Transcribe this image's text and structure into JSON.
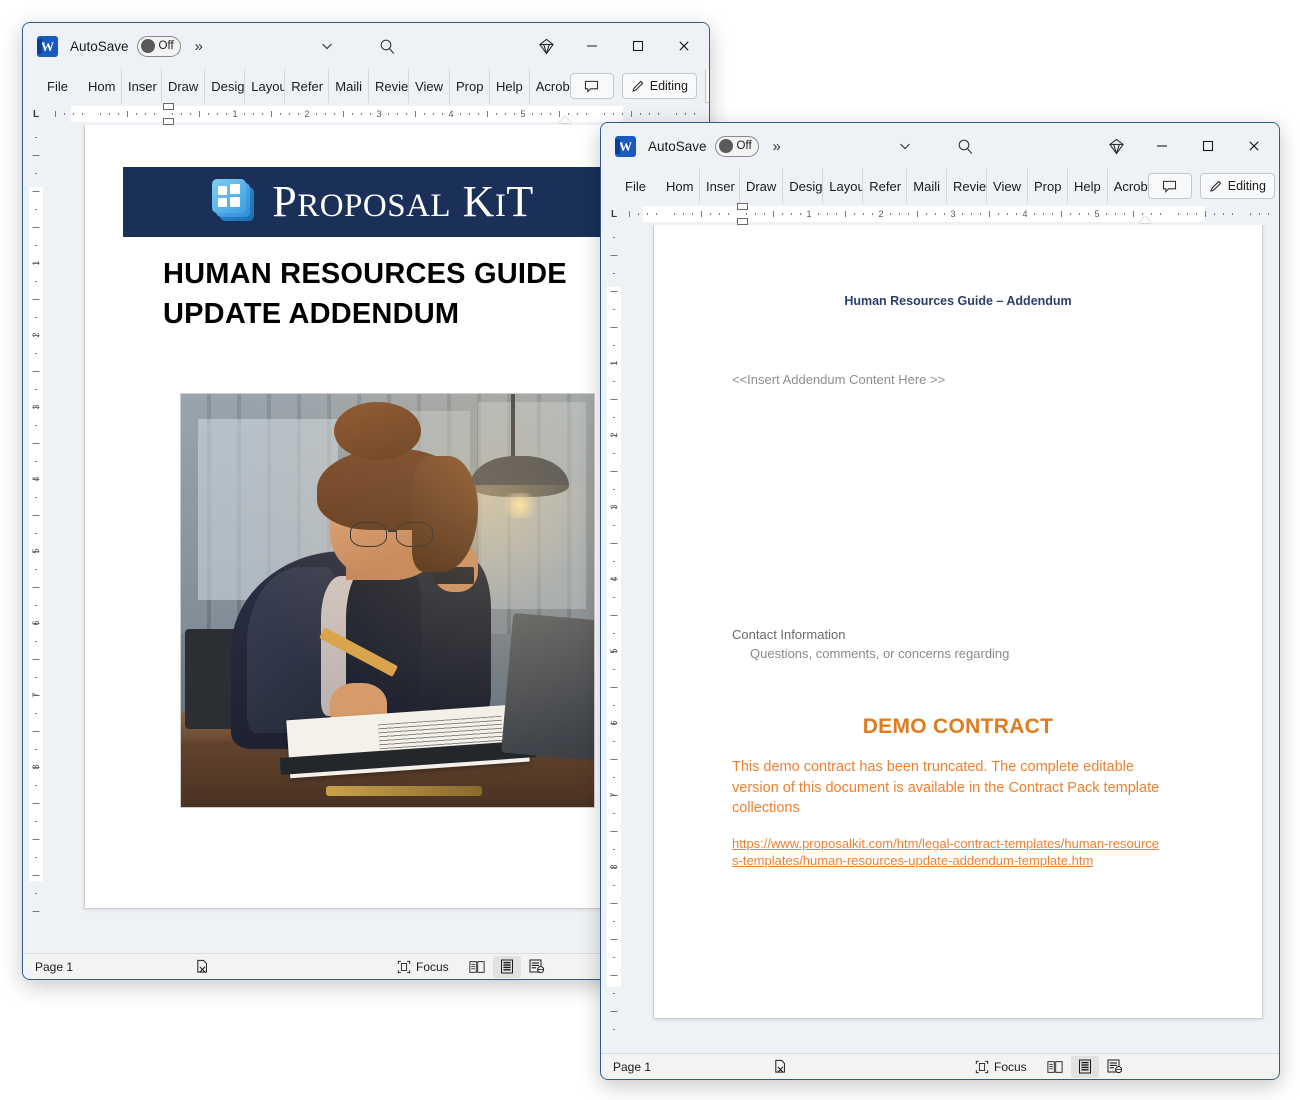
{
  "app": {
    "titlebar": {
      "autosave_label": "AutoSave",
      "toggle_state": "Off",
      "overflow_glyph": "»",
      "caption_chevron": "⌄",
      "search_icon": "search-icon",
      "copilot_icon": "copilot-diamond-icon",
      "minimize_icon": "minimize-icon",
      "maximize_icon": "maximize-icon",
      "close_icon": "close-icon"
    },
    "ribbon": {
      "tabs": [
        "File",
        "Home",
        "Insert",
        "Draw",
        "Design",
        "Layout",
        "References",
        "Mailings",
        "Review",
        "View",
        "Properties",
        "Help",
        "Acrobat"
      ],
      "tabs_display": [
        "File",
        "Hom",
        "Inser",
        "Draw",
        "Desig",
        "Layou",
        "Refer",
        "Maili",
        "Revie",
        "View",
        "Prop",
        "Help",
        "Acrob"
      ],
      "comment_button": "Comments",
      "editing_button": "Editing",
      "editing_overflow_glyph": "›"
    },
    "ruler": {
      "tab_selector": "L",
      "h_numbers": [
        "1",
        "2",
        "3",
        "4",
        "5"
      ],
      "v_numbers": [
        "1",
        "2",
        "3",
        "4",
        "5",
        "6",
        "7",
        "8"
      ]
    },
    "statusbar": {
      "page_label": "Page 1",
      "proofing_icon": "proofing-errors-icon",
      "focus_label": "Focus",
      "view_read_icon": "read-mode-icon",
      "view_print_icon": "print-layout-icon",
      "view_web_icon": "web-layout-icon"
    }
  },
  "colors": {
    "banner_navy": "#1b3058",
    "accent_orange": "#ef8030",
    "demo_orange": "#e07b1e",
    "heading_navy": "#2b3f6c",
    "window_border": "#2f5c8f"
  },
  "window_back": {
    "document": {
      "banner_brand": "PROPOSAL KIT",
      "banner_brand_main": "ROPOSAL",
      "banner_brand_cap_p": "P",
      "banner_brand_k": "K",
      "banner_brand_i": "I",
      "banner_brand_t": "T",
      "logo_icon": "proposal-kit-logo-icon",
      "title_line1": "HUMAN RESOURCES GUIDE",
      "title_line2": "UPDATE ADDENDUM",
      "photo_alt": "businesswoman-writing-at-desk-illustration"
    }
  },
  "window_front": {
    "document": {
      "header": "Human Resources Guide – Addendum",
      "placeholder": "<<Insert Addendum Content Here >>",
      "contact_heading": "Contact Information",
      "contact_body": "Questions, comments, or concerns regarding",
      "demo_title": "DEMO CONTRACT",
      "demo_paragraph": "This demo contract has been truncated. The complete editable version of this document is available in the Contract Pack template collections",
      "demo_link": "https://www.proposalkit.com/htm/legal-contract-templates/human-resources-templates/human-resources-update-addendum-template.htm"
    }
  }
}
